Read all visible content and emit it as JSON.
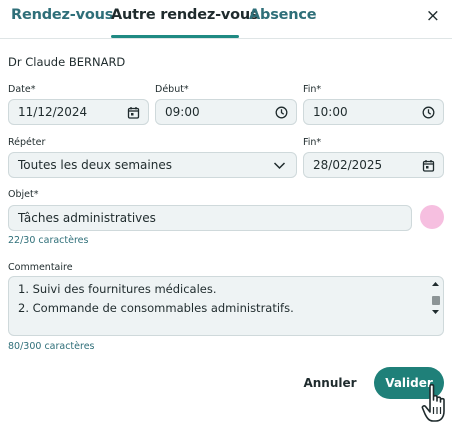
{
  "tabs": [
    {
      "label": "Rendez-vous",
      "active": false
    },
    {
      "label": "Autre rendez-vous",
      "active": true
    },
    {
      "label": "Absence",
      "active": false
    }
  ],
  "close_label": "×",
  "doctor": "Dr Claude BERNARD",
  "date": {
    "label": "Date*",
    "value": "11/12/2024",
    "icon": "calendar-icon"
  },
  "start": {
    "label": "Début*",
    "value": "09:00",
    "icon": "clock-icon"
  },
  "end": {
    "label": "Fin*",
    "value": "10:00",
    "icon": "clock-icon"
  },
  "repeat": {
    "label": "Répéter",
    "value": "Toutes les deux semaines",
    "icon": "chevron-down-icon"
  },
  "repeat_end": {
    "label": "Fin*",
    "value": "28/02/2025",
    "icon": "calendar-icon"
  },
  "subject": {
    "label": "Objet*",
    "value": "Tâches administratives",
    "counter": "22/30 caractères",
    "color": "#f6bfe0"
  },
  "comment": {
    "label": "Commentaire",
    "lines": [
      "1. Suivi des fournitures médicales.",
      "2. Commande de consommables administratifs."
    ],
    "counter": "80/300 caractères"
  },
  "buttons": {
    "cancel": "Annuler",
    "submit": "Valider"
  },
  "colors": {
    "accent": "#1f8079",
    "tab_inactive": "#2f6f79",
    "field_bg": "#eef3f4"
  }
}
